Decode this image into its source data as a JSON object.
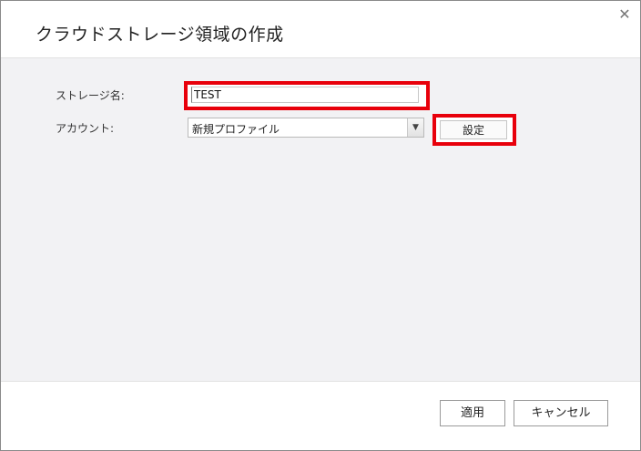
{
  "dialog": {
    "title": "クラウドストレージ領域の作成",
    "close_glyph": "✕"
  },
  "form": {
    "storage_name_label": "ストレージ名:",
    "storage_name_value": "TEST",
    "account_label": "アカウント:",
    "account_selected": "新規プロファイル",
    "dropdown_glyph": "▼",
    "settings_label": "設定"
  },
  "footer": {
    "apply_label": "適用",
    "cancel_label": "キャンセル"
  },
  "colors": {
    "highlight": "#e8000b",
    "body_background": "#f2f2f4"
  }
}
